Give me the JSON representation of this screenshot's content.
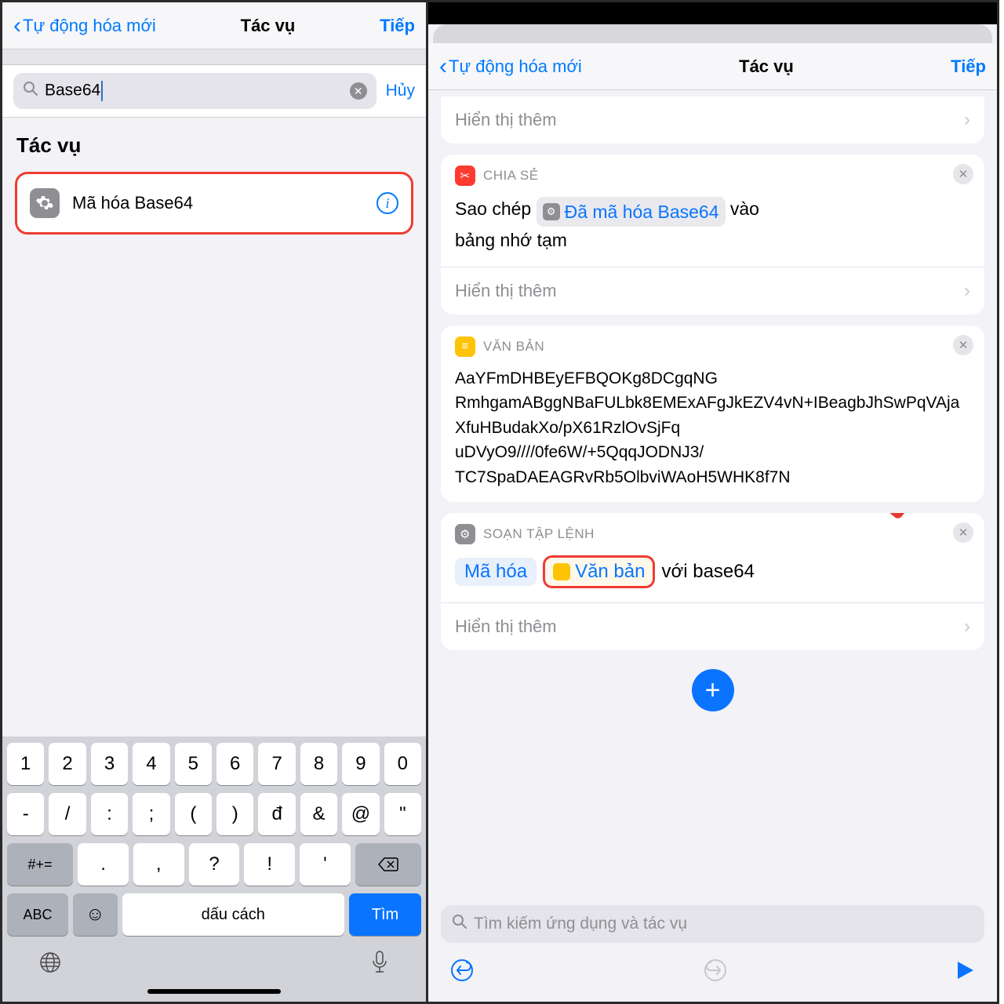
{
  "nav": {
    "back": "Tự động hóa mới",
    "title": "Tác vụ",
    "next": "Tiếp"
  },
  "search": {
    "value": "Base64",
    "cancel": "Hủy"
  },
  "section_heading": "Tác vụ",
  "result": {
    "label": "Mã hóa Base64"
  },
  "keyboard": {
    "row1": [
      "1",
      "2",
      "3",
      "4",
      "5",
      "6",
      "7",
      "8",
      "9",
      "0"
    ],
    "row2": [
      "-",
      "/",
      ":",
      ";",
      "(",
      ")",
      "đ",
      "&",
      "@",
      "\""
    ],
    "row3_mod": "#+=",
    "row3": [
      ".",
      ",",
      "?",
      "!",
      "'"
    ],
    "abc": "ABC",
    "space": "dấu cách",
    "find": "Tìm"
  },
  "right": {
    "show_more": "Hiển thị thêm",
    "share": {
      "header": "CHIA SẺ",
      "prefix": "Sao chép",
      "chip": "Đã mã hóa Base64",
      "suffix_1": "vào",
      "suffix_2": "bảng nhớ tạm"
    },
    "text_block": {
      "header": "VĂN BẢN",
      "content": "AaYFmDHBEyEFBQOKg8DCgqNG\nRmhgamABggNBaFULbk8EMExAFgJkEZV4vN+IBeagbJhSwPqVAjaXfuHBudakXo/pX61RzlOvSjFq\nuDVyO9////0fe6W/+5QqqJODNJ3/\nTC7SpaDAEAGRvRb5OlbviWAoH5WHK8f7N"
    },
    "script": {
      "header": "SOẠN TẬP LỆNH",
      "encode": "Mã hóa",
      "text_chip": "Văn bản",
      "with": "với base64"
    },
    "search_placeholder": "Tìm kiếm ứng dụng và tác vụ"
  }
}
